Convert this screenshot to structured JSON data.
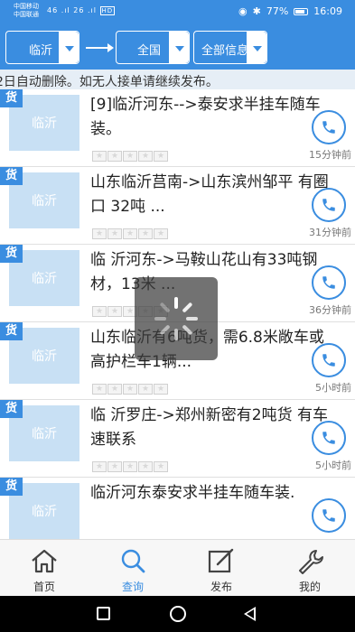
{
  "status_bar": {
    "carrier1": "中国移动",
    "carrier2": "中国联通",
    "signal": "46 .ıl 26 .ıl",
    "network_badge": "HD",
    "battery": "77%",
    "time": "16:09"
  },
  "filter": {
    "from": "临沂",
    "to": "全国",
    "type": "全部信息"
  },
  "notice": "2日自动删除。如无人接单请继续发布。",
  "list": [
    {
      "tag": "货",
      "thumb": "临沂",
      "text": "[9]临沂河东-->泰安求半挂车随车装。",
      "time": "15分钟前"
    },
    {
      "tag": "货",
      "thumb": "临沂",
      "text": "山东临沂莒南->山东滨州邹平 有圈口 32吨 ...",
      "time": "31分钟前"
    },
    {
      "tag": "货",
      "thumb": "临沂",
      "text": "临 沂河东->马鞍山花山有33吨钢材，13米 ...",
      "time": "36分钟前"
    },
    {
      "tag": "货",
      "thumb": "临沂",
      "text": "山东临沂有6吨货，需6.8米敞车或高护栏车1辆...",
      "time": "5小时前"
    },
    {
      "tag": "货",
      "thumb": "临沂",
      "text": "临 沂罗庄->郑州新密有2吨货 有车速联系",
      "time": "5小时前"
    },
    {
      "tag": "货",
      "thumb": "临沂",
      "text": "临沂河东泰安求半挂车随车装.",
      "time": ""
    }
  ],
  "nav": {
    "home": "首页",
    "query": "查询",
    "publish": "发布",
    "mine": "我的"
  },
  "colors": {
    "accent": "#3a8de0",
    "thumb_bg": "#c8e0f4"
  }
}
